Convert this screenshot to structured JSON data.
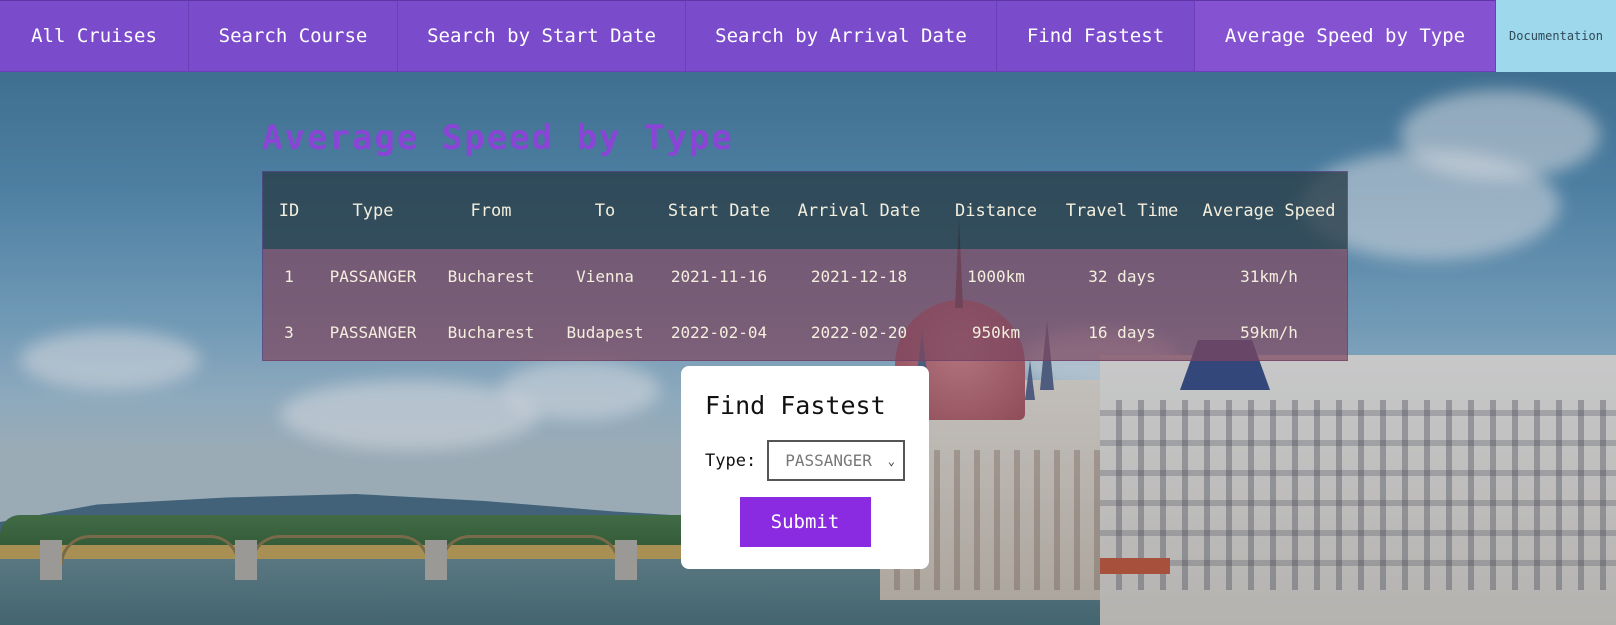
{
  "nav": {
    "items": [
      {
        "label": "All Cruises"
      },
      {
        "label": "Search Course"
      },
      {
        "label": "Search by Start Date"
      },
      {
        "label": "Search by Arrival Date"
      },
      {
        "label": "Find Fastest"
      },
      {
        "label": "Average Speed by Type"
      }
    ],
    "documentation": "Documentation"
  },
  "page": {
    "title": "Average Speed by Type"
  },
  "table": {
    "headers": [
      "ID",
      "Type",
      "From",
      "To",
      "Start Date",
      "Arrival Date",
      "Distance",
      "Travel Time",
      "Average Speed"
    ],
    "rows": [
      [
        "1",
        "PASSANGER",
        "Bucharest",
        "Vienna",
        "2021-11-16",
        "2021-12-18",
        "1000km",
        "32 days",
        "31km/h"
      ],
      [
        "3",
        "PASSANGER",
        "Bucharest",
        "Budapest",
        "2022-02-04",
        "2022-02-20",
        "950km",
        "16 days",
        "59km/h"
      ]
    ]
  },
  "form": {
    "title": "Find Fastest",
    "type_label": "Type:",
    "type_value": "PASSANGER",
    "submit_label": "Submit"
  },
  "colors": {
    "nav_bg": "#7a4ccc",
    "doc_bg": "#9dd8ec",
    "title": "#8a44d6",
    "submit": "#8a2be2"
  }
}
